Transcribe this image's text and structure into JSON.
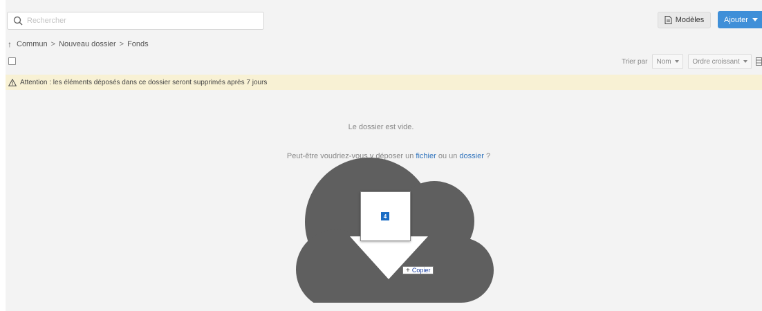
{
  "search": {
    "placeholder": "Rechercher",
    "value": ""
  },
  "toolbar": {
    "models_label": "Modèles",
    "add_label": "Ajouter"
  },
  "breadcrumb": {
    "up_glyph": "↑",
    "items": [
      "Commun",
      "Nouveau dossier",
      "Fonds"
    ],
    "separator": ">"
  },
  "sort": {
    "label": "Trier par",
    "field": "Nom",
    "order": "Ordre croissant"
  },
  "warning": {
    "text": "Attention : les éléments déposés dans ce dossier seront supprimés après 7 jours"
  },
  "empty_state": {
    "title": "Le dossier est vide.",
    "hint_before": "Peut-être voudriez-vous y déposer un",
    "file_link": "fichier",
    "hint_middle": "ou un",
    "folder_link": "dossier",
    "hint_after": "?"
  },
  "drag": {
    "count": "4",
    "action_symbol": "+",
    "action_label": "Copier"
  },
  "colors": {
    "accent": "#3f8fd8",
    "link": "#2f73bd",
    "warning_bg": "#f8f1d4",
    "cloud": "#5f5f5f",
    "badge": "#1a6cc4"
  }
}
